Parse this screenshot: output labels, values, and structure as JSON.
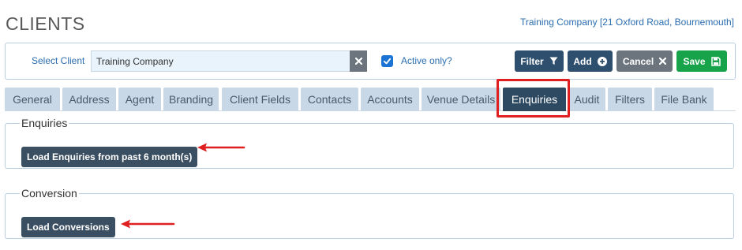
{
  "header": {
    "title": "CLIENTS",
    "company_info": "Training Company [21 Oxford Road, Bournemouth]"
  },
  "toolbar": {
    "select_label": "Select Client",
    "client_value": "Training Company",
    "active_only_label": "Active only?",
    "active_only_checked": true,
    "filter_label": "Filter",
    "add_label": "Add",
    "cancel_label": "Cancel",
    "save_label": "Save"
  },
  "tabs": [
    {
      "label": "General"
    },
    {
      "label": "Address"
    },
    {
      "label": "Agent"
    },
    {
      "label": "Branding"
    },
    {
      "label": "Client Fields"
    },
    {
      "label": "Contacts"
    },
    {
      "label": "Accounts"
    },
    {
      "label": "Venue Details"
    },
    {
      "label": "Enquiries",
      "active": true
    },
    {
      "label": "Audit"
    },
    {
      "label": "Filters"
    },
    {
      "label": "File Bank"
    }
  ],
  "sections": {
    "enquiries": {
      "legend": "Enquiries",
      "button_label": "Load Enquiries from past 6 month(s)"
    },
    "conversion": {
      "legend": "Conversion",
      "button_label": "Load Conversions"
    }
  },
  "colors": {
    "accent_dark": "#2e4f6d",
    "save_green": "#17a34a",
    "highlight_red": "#e02020",
    "link_blue": "#2a6db0"
  }
}
